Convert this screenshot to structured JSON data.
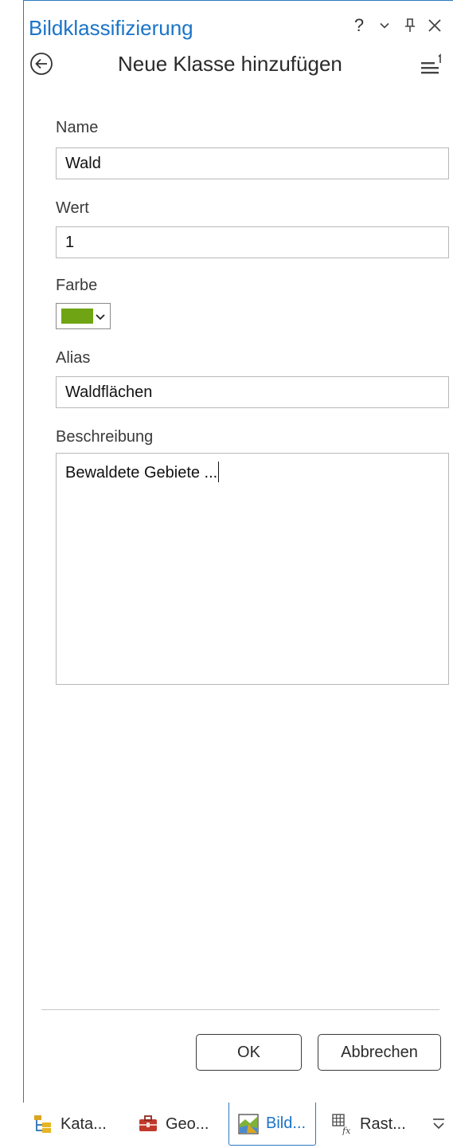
{
  "header": {
    "title": "Bildklassifizierung",
    "help_label": "?",
    "page_title": "Neue Klasse hinzufügen"
  },
  "form": {
    "name_label": "Name",
    "name_value": "Wald",
    "value_label": "Wert",
    "value_value": "1",
    "color_label": "Farbe",
    "color_value": "#6fa514",
    "alias_label": "Alias",
    "alias_value": "Waldflächen",
    "description_label": "Beschreibung",
    "description_value": "Bewaldete Gebiete ..."
  },
  "actions": {
    "ok_label": "OK",
    "cancel_label": "Abbrechen"
  },
  "tabs": [
    {
      "label": "Kata...",
      "icon": "catalog-icon"
    },
    {
      "label": "Geo...",
      "icon": "geoprocessing-toolbox-icon"
    },
    {
      "label": "Bild...",
      "icon": "image-classification-icon",
      "active": true
    },
    {
      "label": "Rast...",
      "icon": "raster-functions-icon"
    }
  ],
  "colors": {
    "accent": "#1a74c8",
    "border": "#2a7ac0",
    "swatch": "#6fa514"
  }
}
